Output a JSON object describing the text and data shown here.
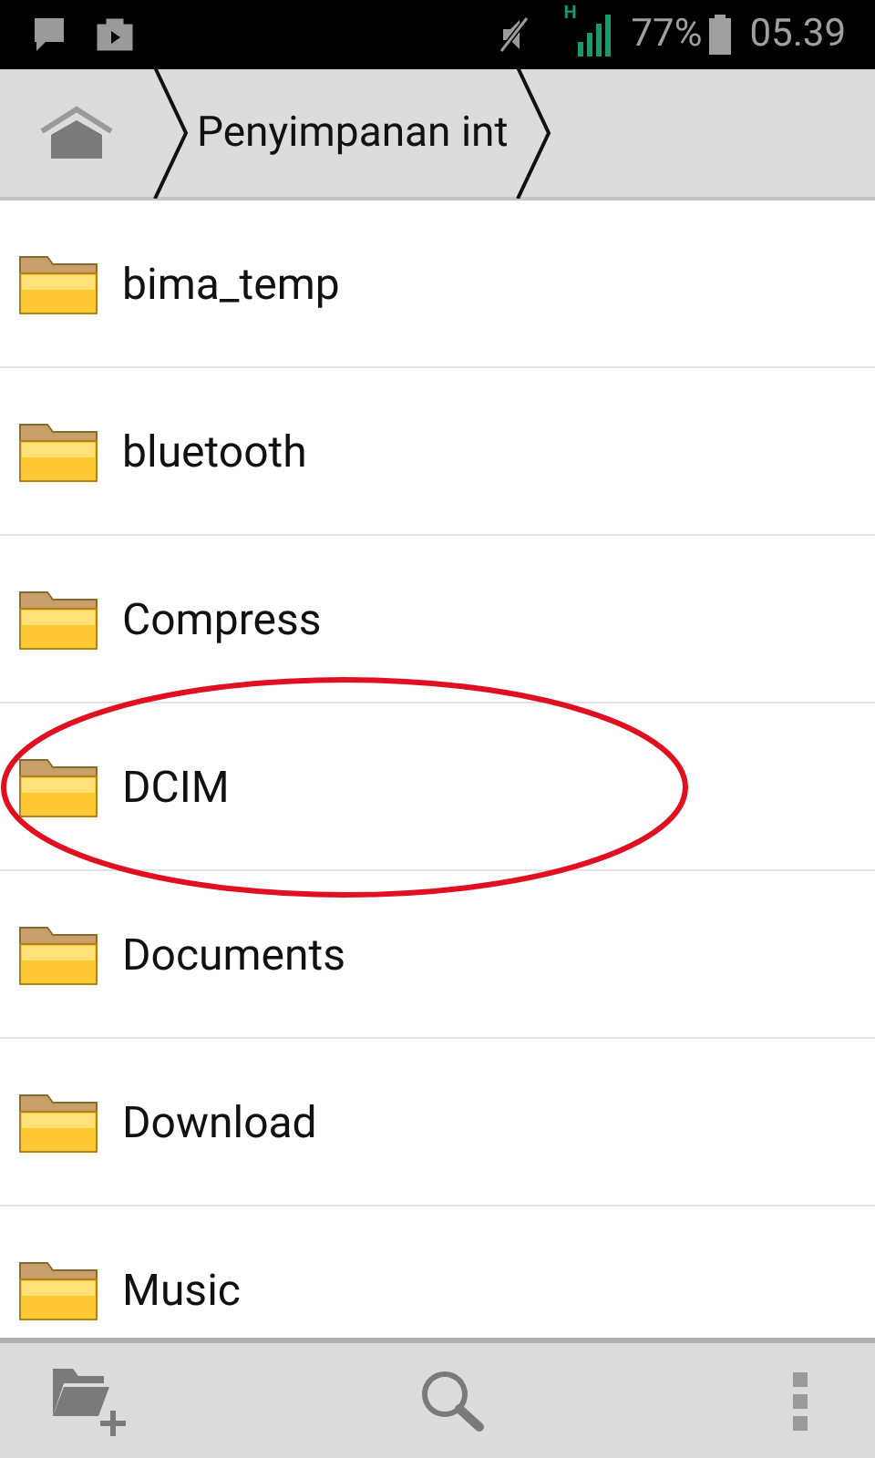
{
  "status_bar": {
    "network_type": "H",
    "battery": "77%",
    "time": "05.39"
  },
  "breadcrumb": {
    "path": "Penyimpanan int"
  },
  "folders": [
    {
      "name": "bima_temp",
      "highlighted": false
    },
    {
      "name": "bluetooth",
      "highlighted": false
    },
    {
      "name": "Compress",
      "highlighted": false
    },
    {
      "name": "DCIM",
      "highlighted": true
    },
    {
      "name": "Documents",
      "highlighted": false
    },
    {
      "name": "Download",
      "highlighted": false
    },
    {
      "name": "Music",
      "highlighted": false
    }
  ]
}
